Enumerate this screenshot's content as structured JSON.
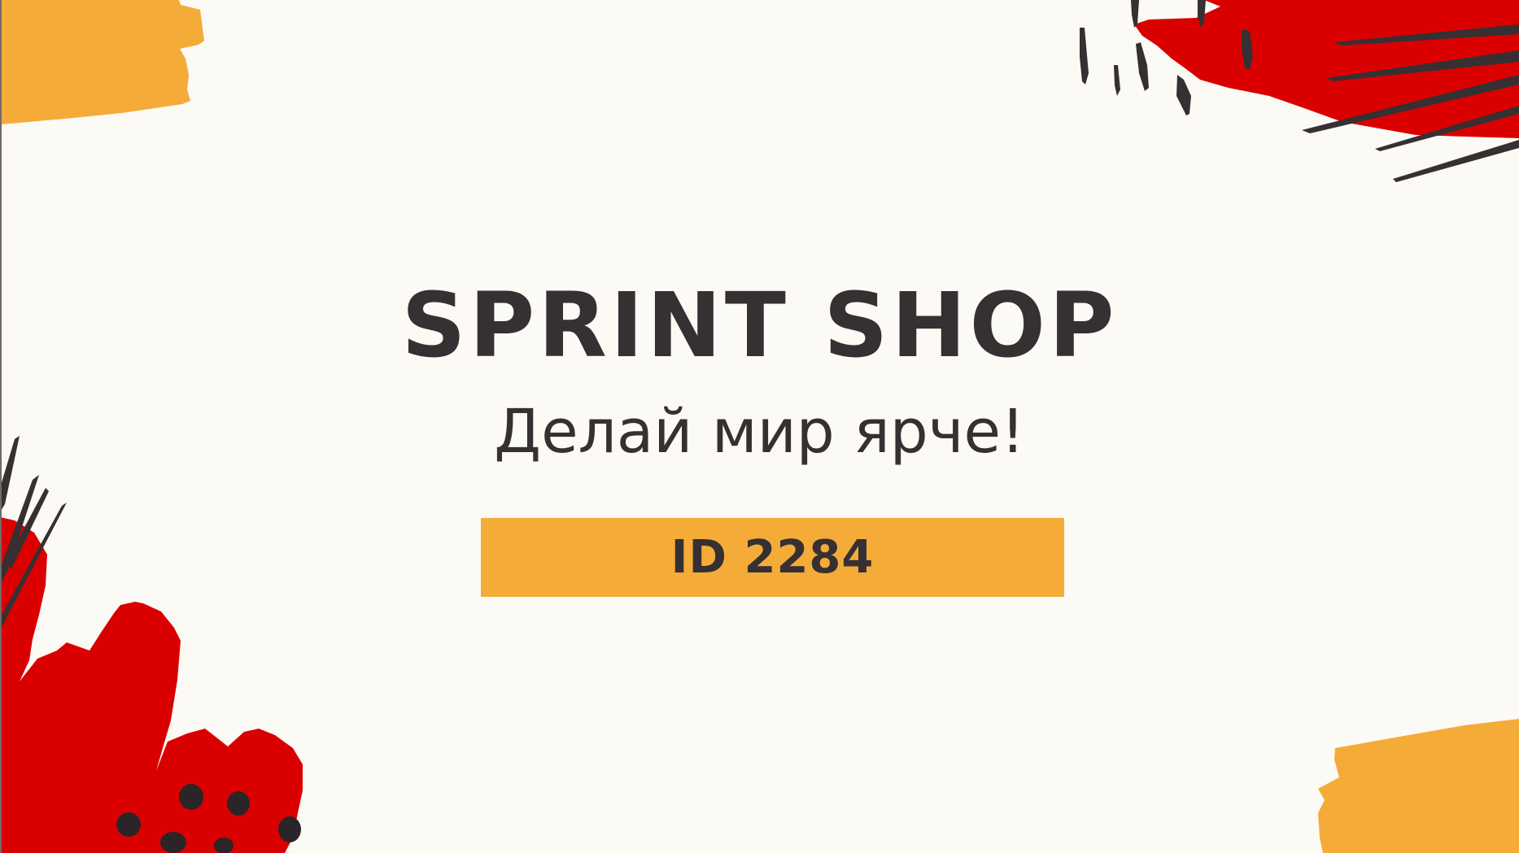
{
  "brand": {
    "title": "SPRINT SHOP",
    "slogan": "Делай мир ярче!",
    "id_label": "ID 2284"
  },
  "colors": {
    "background": "#fbfaf5",
    "text": "#363032",
    "accent_orange": "#f5ab38",
    "accent_red": "#db0000"
  },
  "decorations": [
    "orange-brush-stroke",
    "red-paint-splash",
    "dark-ink-strokes",
    "dark-dots"
  ]
}
